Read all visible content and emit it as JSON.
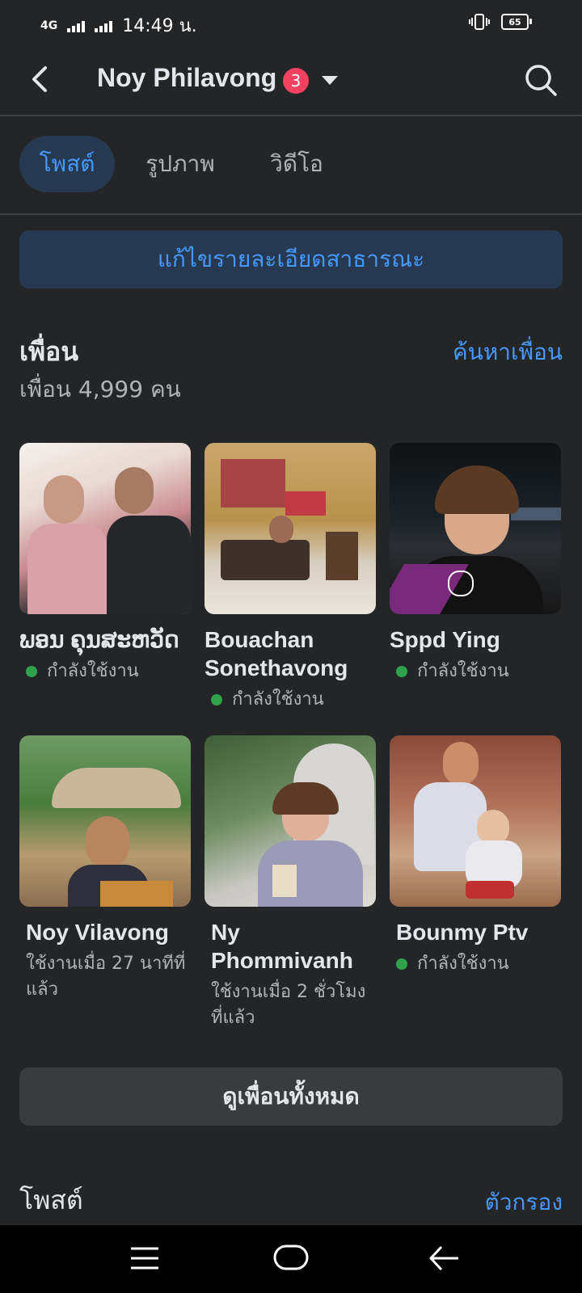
{
  "status_bar": {
    "network": "4G",
    "time": "14:49 น.",
    "battery": "65"
  },
  "header": {
    "title": "Noy Philavong",
    "badge": "3",
    "back_icon": "back-arrow-icon",
    "search_icon": "search-icon"
  },
  "tabs": [
    {
      "label": "โพสต์",
      "active": true
    },
    {
      "label": "รูปภาพ",
      "active": false
    },
    {
      "label": "วิดีโอ",
      "active": false
    }
  ],
  "edit_button": "แก้ไขรายละเอียดสาธารณะ",
  "friends_section": {
    "title": "เพื่อน",
    "find_link": "ค้นหาเพื่อน",
    "count": "เพื่อน 4,999 คน",
    "friends": [
      {
        "name": "ພອນ ຄຸນສະຫວັດ",
        "status": "กำลังใช้งาน",
        "online": true
      },
      {
        "name": "Bouachan Sonethavong",
        "status": "กำลังใช้งาน",
        "online": true
      },
      {
        "name": "Sppd Ying",
        "status": "กำลังใช้งาน",
        "online": true
      },
      {
        "name": "Noy Vilavong",
        "status": "ใช้งานเมื่อ 27 นาทีที่แล้ว",
        "online": false
      },
      {
        "name": "Ny Phommivanh",
        "status": "ใช้งานเมื่อ 2 ชั่วโมงที่แล้ว",
        "online": false
      },
      {
        "name": "Bounmy Ptv",
        "status": "กำลังใช้งาน",
        "online": true
      }
    ],
    "see_all": "ดูเพื่อนทั้งหมด"
  },
  "posts_section": {
    "title": "โพสต์",
    "filter_link": "ตัวกรอง"
  },
  "colors": {
    "background": "#242526",
    "accent": "#4599ff",
    "online": "#31a24c",
    "badge": "#f3425f"
  }
}
